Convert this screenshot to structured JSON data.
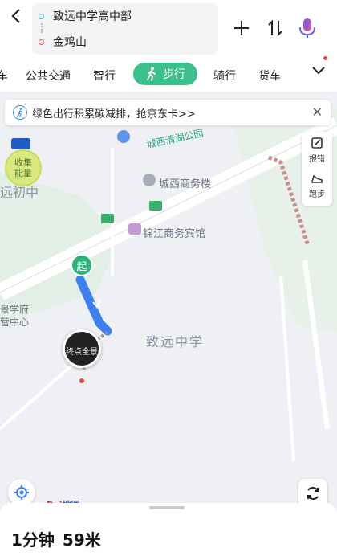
{
  "route": {
    "origin": "致远中学高中部",
    "destination": "金鸡山"
  },
  "tabs": [
    {
      "label": "车"
    },
    {
      "label": "公共交通"
    },
    {
      "label": "智行"
    },
    {
      "label": "步行"
    },
    {
      "label": "骑行"
    },
    {
      "label": "货车"
    }
  ],
  "banner": {
    "text": "绿色出行积累碳减排，抢京东卡>>",
    "close_label": "✕"
  },
  "tools": {
    "report_label": "报错",
    "run_label": "跑步"
  },
  "map": {
    "road_label": "城西清湖公园",
    "poi_building": "城西商务楼",
    "poi_hotel": "锦江商务宾馆",
    "poi_school": "致远中学",
    "poi_left_top": "远初中",
    "poi_left_mid1": "景学府",
    "poi_left_mid2": "营中心",
    "collect_energy": "收集\n能量",
    "start_marker": "起",
    "end_marker": "终点全景",
    "logo_text": "Bai",
    "logo_text2": "地图"
  },
  "summary": {
    "duration": "1分钟",
    "distance": "59米"
  },
  "colors": {
    "accent_green": "#3bbf8c",
    "route_blue": "#3b7ff0"
  }
}
